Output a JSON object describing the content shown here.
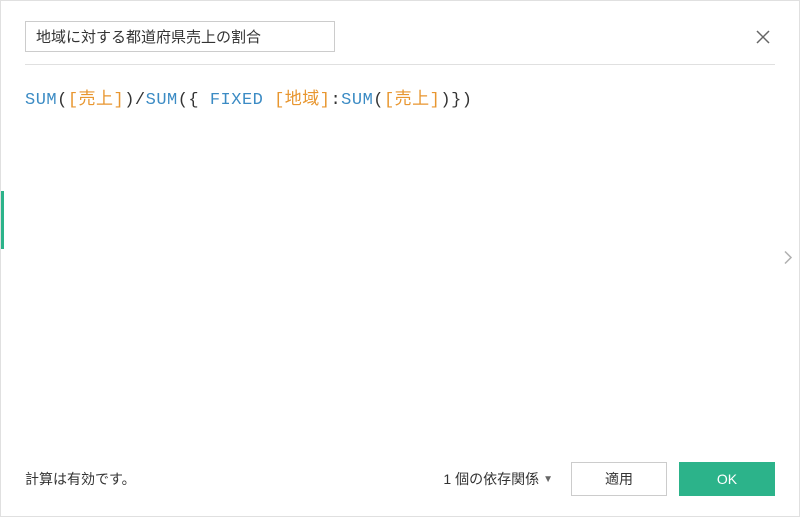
{
  "header": {
    "calc_name": "地域に対する都道府県売上の割合"
  },
  "formula": {
    "tokens": [
      {
        "cls": "tok-func",
        "text": "SUM"
      },
      {
        "cls": "tok-punc",
        "text": "("
      },
      {
        "cls": "tok-field",
        "text": "[売上]"
      },
      {
        "cls": "tok-punc",
        "text": ")/"
      },
      {
        "cls": "tok-func",
        "text": "SUM"
      },
      {
        "cls": "tok-punc",
        "text": "({ "
      },
      {
        "cls": "tok-keyword",
        "text": "FIXED"
      },
      {
        "cls": "tok-punc",
        "text": " "
      },
      {
        "cls": "tok-field",
        "text": "[地域]"
      },
      {
        "cls": "tok-punc",
        "text": ":"
      },
      {
        "cls": "tok-func",
        "text": "SUM"
      },
      {
        "cls": "tok-punc",
        "text": "("
      },
      {
        "cls": "tok-field",
        "text": "[売上]"
      },
      {
        "cls": "tok-punc",
        "text": ")})"
      }
    ]
  },
  "footer": {
    "status": "計算は有効です。",
    "dependencies_label": "1 個の依存関係",
    "apply_label": "適用",
    "ok_label": "OK"
  }
}
